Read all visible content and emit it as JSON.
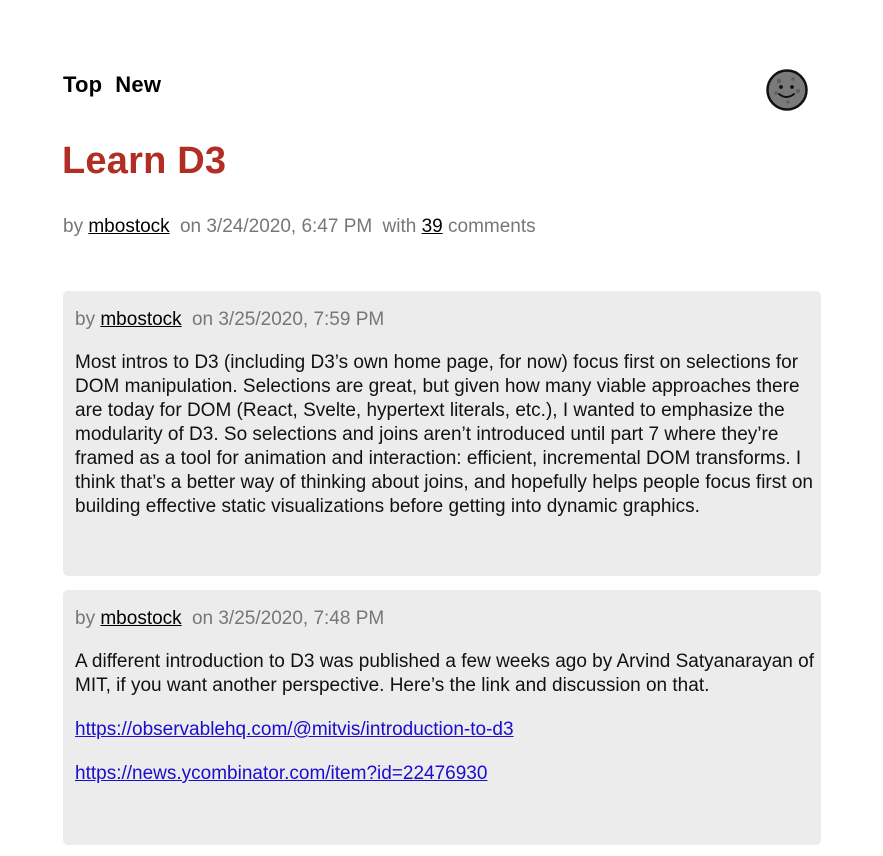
{
  "nav": {
    "top_label": "Top",
    "new_label": "New"
  },
  "avatar": {
    "icon": "smiley-face-icon"
  },
  "story": {
    "title": "Learn D3",
    "by": "by",
    "author": "mbostock",
    "on_date": "on 3/24/2020, 6:47 PM",
    "with": "with",
    "comment_count": "39",
    "comments_word": "comments"
  },
  "comments": [
    {
      "by": "by",
      "author": "mbostock",
      "on_date": "on 3/25/2020, 7:59 PM",
      "paragraphs": [
        "Most intros to D3 (including D3’s own home page, for now) focus first on selections for DOM manipulation. Selections are great, but given how many viable approaches there are today for DOM (React, Svelte, hypertext literals, etc.), I wanted to emphasize the modularity of D3. So selections and joins aren’t introduced until part 7 where they’re framed as a tool for animation and interaction: efficient, incremental DOM transforms. I think that’s a better way of thinking about joins, and hopefully helps people focus first on building effective static visualizations before getting into dynamic graphics."
      ]
    },
    {
      "by": "by",
      "author": "mbostock",
      "on_date": "on 3/25/2020, 7:48 PM",
      "paragraphs": [
        "A different introduction to D3 was published a few weeks ago by Arvind Satyanarayan of MIT, if you want another perspective. Here’s the link and discussion on that."
      ],
      "links": [
        "https://observablehq.com/@mitvis/introduction-to-d3",
        "https://news.ycombinator.com/item?id=22476930"
      ]
    }
  ],
  "colors": {
    "title": "#b22d24",
    "meta": "#777777",
    "comment_bg": "#ececec",
    "link": "#1a0dcc"
  }
}
